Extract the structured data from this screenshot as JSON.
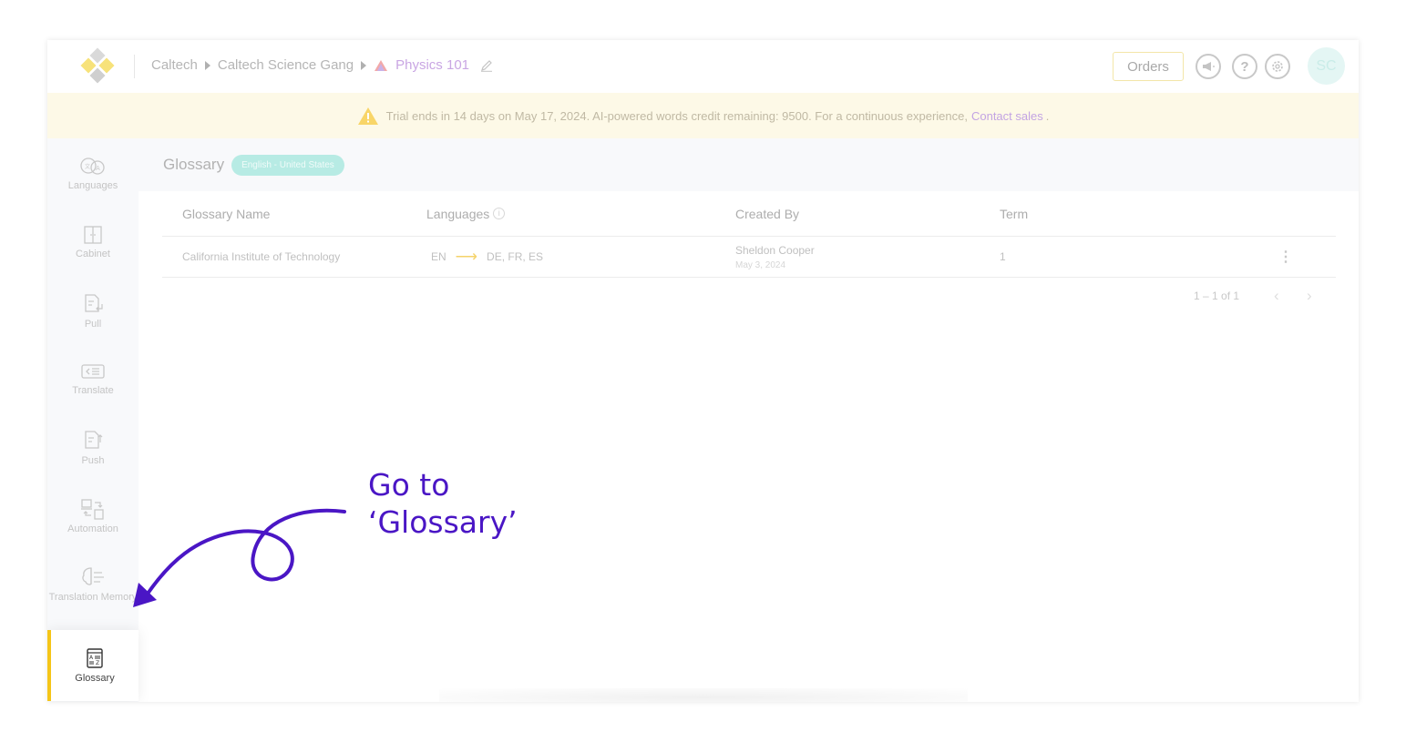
{
  "header": {
    "breadcrumb": [
      "Caltech",
      "Caltech Science Gang",
      "Physics 101"
    ],
    "orders_label": "Orders",
    "avatar_initials": "SC"
  },
  "banner": {
    "text": "Trial ends in 14 days on May 17, 2024. AI-powered words credit remaining: 9500. For a continuous experience,",
    "link": "Contact sales",
    "tail": "."
  },
  "sidebar": {
    "items": [
      {
        "label": "Languages",
        "icon": "languages-icon"
      },
      {
        "label": "Cabinet",
        "icon": "cabinet-icon"
      },
      {
        "label": "Pull",
        "icon": "pull-icon"
      },
      {
        "label": "Translate",
        "icon": "translate-icon"
      },
      {
        "label": "Push",
        "icon": "push-icon"
      },
      {
        "label": "Automation",
        "icon": "automation-icon"
      },
      {
        "label": "Translation Memory",
        "icon": "translation-memory-icon"
      },
      {
        "label": "Glossary",
        "icon": "glossary-icon",
        "active": true
      }
    ]
  },
  "page": {
    "title": "Glossary",
    "locale_badge": "English - United States"
  },
  "table": {
    "columns": [
      "Glossary Name",
      "Languages",
      "Created By",
      "Term"
    ],
    "rows": [
      {
        "name": "California Institute of Technology",
        "source_lang": "EN",
        "target_langs": "DE, FR, ES",
        "creator": "Sheldon Cooper",
        "created_date": "May 3, 2024",
        "terms": "1"
      }
    ],
    "pagination": "1 – 1 of 1"
  },
  "annotation": {
    "line1": "Go to",
    "line2": "‘Glossary’",
    "color": "#4a16c5"
  }
}
